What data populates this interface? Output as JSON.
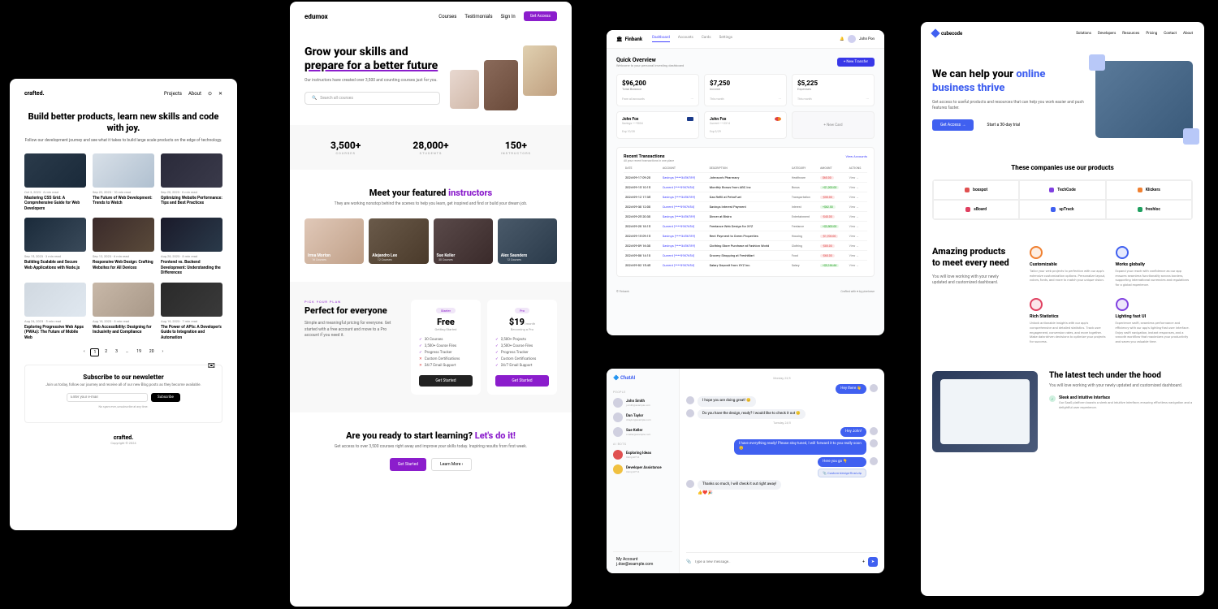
{
  "crafted": {
    "logo": "crafted.",
    "nav": {
      "projects": "Projects",
      "about": "About"
    },
    "hero": {
      "title": "Build better products, learn new skills and code with joy.",
      "subtitle": "Follow our development journey and see what it takes to build large scale products on the edge of technology."
    },
    "posts": [
      {
        "meta": "Oct 3, 2023 · 6 min read",
        "title": "Mastering CSS Grid: A Comprehensive Guide for Web Developers"
      },
      {
        "meta": "Sep 22, 2023 · 10 min read",
        "title": "The Future of Web Development: Trends to Watch"
      },
      {
        "meta": "Sep 20, 2023 · 8 min read",
        "title": "Optimizing Website Performance: Tips and Best Practices"
      },
      {
        "meta": "Sep 15, 2023 · 3 min read",
        "title": "Building Scalable and Secure Web Applications with Node.js"
      },
      {
        "meta": "Sep 12, 2023 · 6 min read",
        "title": "Responsive Web Design: Crafting Websites for All Devices"
      },
      {
        "meta": "Aug 28, 2023 · 8 min read",
        "title": "Frontend vs. Backend Development: Understanding the Differences"
      },
      {
        "meta": "Aug 24, 2023 · 5 min read",
        "title": "Exploring Progressive Web Apps (PWAs): The Future of Mobile Web"
      },
      {
        "meta": "Aug 18, 2023 · 8 min read",
        "title": "Web Accessibility: Designing for Inclusivity and Compliance"
      },
      {
        "meta": "Aug 18, 2023 · 7 min read",
        "title": "The Power of APIs: A Developer's Guide to Integration and Automation"
      }
    ],
    "pager": [
      "‹",
      "1",
      "2",
      "3",
      "…",
      "19",
      "20",
      "›"
    ],
    "newsletter": {
      "title": "Subscribe to our newsletter",
      "desc": "Join us today, follow our journey and receive all of our new Blog posts as they become available.",
      "placeholder": "Enter your e-mail",
      "button": "Subscribe",
      "note": "No spam ever, unsubscribe at any time."
    },
    "footer": {
      "logo": "crafted.",
      "copy": "Copyright © 2024"
    }
  },
  "edumax": {
    "logo": "edumox",
    "nav": {
      "courses": "Courses",
      "testimonials": "Testimonials",
      "signin": "Sign In",
      "cta": "Get Access"
    },
    "hero": {
      "title1": "Grow your skills and ",
      "title2": "prepare for a better future",
      "sub": "Our instructors have created over 3,500 and counting courses just for you.",
      "search": "Search all courses"
    },
    "stats": [
      {
        "num": "3,500+",
        "lbl": "Courses"
      },
      {
        "num": "28,000+",
        "lbl": "Students"
      },
      {
        "num": "150+",
        "lbl": "Instructors"
      }
    ],
    "instructors": {
      "title1": "Meet your featured ",
      "title2": "instructors",
      "sub": "They are working nonstop behind the scenes to help you learn, get inspired and find or build your dream job.",
      "list": [
        {
          "name": "Irma Morton",
          "role": "16 Courses"
        },
        {
          "name": "Alejandro Lee",
          "role": "12 Courses"
        },
        {
          "name": "Sue Keller",
          "role": "30 Courses"
        },
        {
          "name": "Alex Saunders",
          "role": "12 Courses"
        }
      ]
    },
    "pricing": {
      "tag": "Pick Your Plan",
      "title": "Perfect for everyone",
      "sub": "Simple and meaningful pricing for everyone. Get started with a free account and move to a Pro account if you need it.",
      "free": {
        "badge": "Starter",
        "price": "Free",
        "sub": "Getting Started",
        "features": [
          "30 Courses",
          "3,500+ Course Files",
          "Progress Tracker",
          "Custom Certifications",
          "24/7 Email Support"
        ],
        "button": "Get Started"
      },
      "pro": {
        "badge": "Pro",
        "price": "$19",
        "per": "/month",
        "sub": "Becoming a Pro",
        "features": [
          "2,500+ Projects",
          "3,500+ Course Files",
          "Progress Tracker",
          "Custom Certifications",
          "24/7 Email Support"
        ],
        "button": "Get Started"
      }
    },
    "cta": {
      "title1": "Are you ready to start learning? ",
      "title2": "Let's do it!",
      "sub": "Get access to over 3,500 courses right away and improve your skills today. Inspiring results from first week.",
      "primary": "Get Started",
      "secondary": "Learn More ›"
    }
  },
  "finbank": {
    "brand": "Finbank",
    "tabs": [
      "Dashboard",
      "Accounts",
      "Cards",
      "Settings"
    ],
    "user": "John Pon",
    "overview": {
      "title": "Quick Overview",
      "sub": "Welcome to your personal investing dashboard",
      "button": "+ New Transfer"
    },
    "summary": [
      {
        "amt": "$96,200",
        "lbl": "Total Balance",
        "btm": "From all accounts"
      },
      {
        "amt": "$7,250",
        "lbl": "Income",
        "btm": "This month"
      },
      {
        "amt": "$5,225",
        "lbl": "Expenses",
        "btm": "This month"
      }
    ],
    "accounts": [
      {
        "name": "John Fox",
        "num": "Savings ••••9034",
        "exp": "Exp 10/28",
        "type": "visa"
      },
      {
        "name": "John Fox",
        "num": "Current ••••2314",
        "exp": "Exp 3/29",
        "type": "mc"
      },
      {
        "new": "+ New Card"
      }
    ],
    "trans": {
      "title": "Recent Transactions",
      "sub": "All your recent transactions in one place",
      "link": "View Accounts",
      "cols": [
        "Date",
        "Account",
        "Description",
        "Category",
        "Amount",
        "Actions"
      ],
      "rows": [
        {
          "date": "2024-09-17 09:20",
          "acct": "Savings (****3456789)",
          "desc": "Johnson's Pharmacy",
          "cat": "Healthcare",
          "amt": "$60.00",
          "neg": true
        },
        {
          "date": "2024-09-15 10:15",
          "acct": "Current (****3987654)",
          "desc": "Monthly Bonus from ABC Inc",
          "cat": "Bonus",
          "amt": "+$1,200.00",
          "neg": false
        },
        {
          "date": "2024-09-12 17:35",
          "acct": "Savings (****3456789)",
          "desc": "Gas Refill at PetroFuel",
          "cat": "Transportation",
          "amt": "-$50.00",
          "neg": true
        },
        {
          "date": "2024-09-30 12:00",
          "acct": "Current (****3987654)",
          "desc": "Savings Interest Payment",
          "cat": "Interest",
          "amt": "+$62.50",
          "neg": false
        },
        {
          "date": "2024-09-25 20:30",
          "acct": "Savings (****3456789)",
          "desc": "Dinner at Bistro",
          "cat": "Entertainment",
          "amt": "-$40.00",
          "neg": true
        },
        {
          "date": "2024-09-20 18:15",
          "acct": "Current (****3987654)",
          "desc": "Freelance Web Design for XYZ",
          "cat": "Freelance",
          "amt": "+$3,500.00",
          "neg": false
        },
        {
          "date": "2024-09-15 09:15",
          "acct": "Savings (****3456789)",
          "desc": "Rent Payment to Green Properties",
          "cat": "Housing",
          "amt": "-$1,700.00",
          "neg": true
        },
        {
          "date": "2024-09-09 16:30",
          "acct": "Savings (****3456789)",
          "desc": "Clothing Store Purchase at Fashion World",
          "cat": "Clothing",
          "amt": "-$85.00",
          "neg": true
        },
        {
          "date": "2024-09-08 14:10",
          "acct": "Current (****3987654)",
          "desc": "Grocery Shopping at FreshMart",
          "cat": "Food",
          "amt": "-$60.00",
          "neg": true
        },
        {
          "date": "2024-09-02 15:45",
          "acct": "Current (****3987654)",
          "desc": "Salary Deposit from XYZ Inc.",
          "cat": "Salary",
          "amt": "+$5,166.66",
          "neg": false
        }
      ],
      "view": "View →"
    },
    "footer": {
      "left": "© Finbank",
      "right": "Crafted with ♥ by pixelcave"
    }
  },
  "chat": {
    "logo": "🔷 ChatAI",
    "people_label": "People",
    "people": [
      {
        "name": "John Smith",
        "email": "j.smith@example.com"
      },
      {
        "name": "Dan Taylor",
        "email": "d.taylor@example.com"
      },
      {
        "name": "Sue Keller",
        "email": "s.keller@example.com"
      }
    ],
    "bots_label": "AI Bots",
    "bots": [
      {
        "name": "Exploring Ideas",
        "sub": "Using GPT-4",
        "color": "red"
      },
      {
        "name": "Developer Assistance",
        "sub": "Using GPT-4",
        "color": "yellow"
      }
    ],
    "account": {
      "label": "My Account",
      "email": "j.doe@example.com"
    },
    "days": {
      "mon": "Monday, 23/5",
      "tue": "Tuesday, 24/5"
    },
    "msgs": [
      {
        "text": "Hey there 👋",
        "right": true
      },
      {
        "text": "I hope you are doing great! 😊",
        "right": false
      },
      {
        "text": "Do you have the design, ready? I would like to check it out 🙂",
        "right": false
      },
      {
        "text": "Hey John!",
        "right": true
      },
      {
        "text": "I have everything ready! Please stay tuned, I will forward it to you really soon 😊",
        "right": true
      },
      {
        "text": "Here you go 👇",
        "right": true,
        "attach": "📎 Custom-design-final.zip"
      },
      {
        "text": "Thanks so much, I will check it out right away!",
        "right": false,
        "reactions": "👍❤️🎉"
      }
    ],
    "input": {
      "placeholder": "Type a new message.."
    }
  },
  "cube": {
    "logo": "cubecode",
    "nav": [
      "Solutions",
      "Developers",
      "Resources",
      "Pricing",
      "Contact",
      "About"
    ],
    "hero": {
      "title1": "We can help your ",
      "title2": "online business thrive",
      "sub": "Get access to useful products and resources that can help you work easier and push features faster.",
      "primary": "Get Access →",
      "secondary": "Start a 30-day trial"
    },
    "companies": {
      "title": "These companies use our products",
      "list": [
        {
          "name": "boxspot",
          "color": "#e05050"
        },
        {
          "name": "TechCode",
          "color": "#8040e0"
        },
        {
          "name": "Klickers",
          "color": "#f08030"
        },
        {
          "name": "sBoard",
          "color": "#e04060"
        },
        {
          "name": "upTruck",
          "color": "#4060f0"
        },
        {
          "name": "freshloc",
          "color": "#20a060"
        }
      ]
    },
    "features": {
      "title": "Amazing products to meet every need",
      "sub": "You will love working with your newly updated and customized dashboard.",
      "list": [
        {
          "title": "Customizable",
          "desc": "Tailor your web projects to perfection with our app's extensive customization options. Personalize layout, colors, fonts, and more to match your unique vision.",
          "color": "#f08030"
        },
        {
          "title": "Works globally",
          "desc": "Expand your reach with confidence as our app ensures seamless functionality across borders, supporting international currencies and regulations for a global experience.",
          "color": "#4060f0"
        },
        {
          "title": "Rich Statistics",
          "desc": "Unlock actionable insights with our app's comprehensive and detailed statistics. Track user engagement, conversion rates, and more together. Make data-driven decisions to optimize your projects for success.",
          "color": "#e04060"
        },
        {
          "title": "Lighting fast UI",
          "desc": "Experience swift, seamless performance and efficiency with our app's lighting-fast user interface. Enjoy swift navigation, instant responses, and a smooth workflow that maximizes your productivity and saves you valuable time.",
          "color": "#8040e0"
        }
      ]
    },
    "tech": {
      "title": "The latest tech under the hood",
      "sub": "You will love working with your newly updated and customized dashboard.",
      "items": [
        {
          "title": "Sleek and Intuitive Interface",
          "desc": "Our SaaS platform boasts a sleek and intuitive interface, ensuring effortless navigation and a delightful user experience."
        }
      ]
    }
  }
}
